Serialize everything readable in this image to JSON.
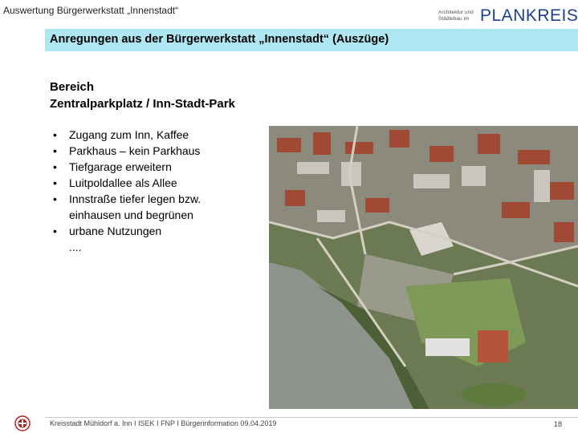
{
  "header": {
    "title": "Auswertung Bürgerwerkstatt „Innenstadt“",
    "logo_small_line1": "Architektur und",
    "logo_small_line2": "Städtebau im",
    "logo_name": "PLANKREIS"
  },
  "banner": {
    "text": "Anregungen aus der Bürgerwerkstatt „Innenstadt“ (Auszüge)",
    "color": "#aee6f2"
  },
  "section": {
    "label": "Bereich",
    "title": "Zentralparkplatz / Inn-Stadt-Park"
  },
  "bullets": [
    "Zugang zum Inn, Kaffee",
    "Parkhaus – kein Parkhaus",
    "Tiefgarage erweitern",
    "Luitpoldallee als Allee",
    "Innstraße tiefer legen bzw.",
    "urbane Nutzungen"
  ],
  "bullet_continuation": "einhausen und begrünen",
  "ellipsis": "....",
  "footer": {
    "text": "Kreisstadt Mühldorf a. Inn  I  ISEK  I  FNP  I  Bürgerinformation 09.04.2019",
    "page": "18"
  },
  "icons": {
    "bullet": "bullet-dot-icon",
    "seal": "city-seal-icon"
  }
}
